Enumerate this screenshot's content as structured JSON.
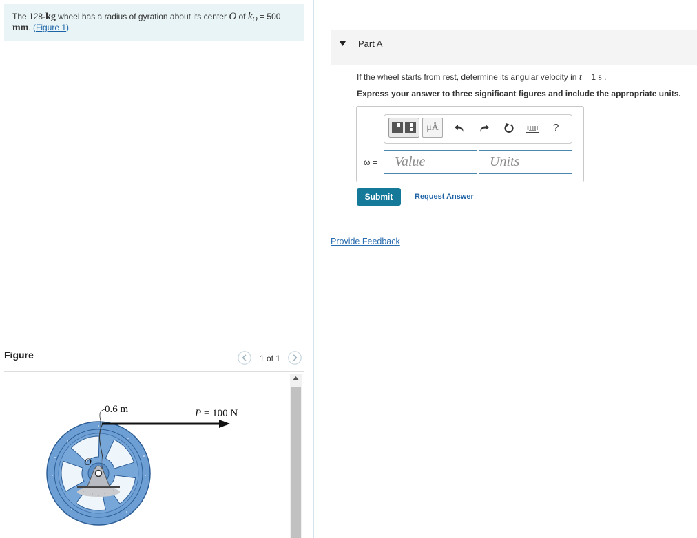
{
  "problem": {
    "text_1": "The 128-",
    "kg": "kg",
    "text_2": " wheel has a radius of gyration about its center ",
    "center_symbol": "O",
    "text_3": " of ",
    "k_symbol": "k",
    "k_subscript": "O",
    "text_4": " = 500",
    "unit": "mm",
    "text_5": ". ",
    "paren_open": "(",
    "figure_link": "Figure 1",
    "paren_close": ")"
  },
  "figure_panel": {
    "title": "Figure",
    "pager": "1 of 1",
    "prev_icon": "chevron-left-icon",
    "next_icon": "chevron-right-icon",
    "labels": {
      "radius": "0.6 m",
      "force_symbol": "P",
      "force_value": " = 100 N",
      "center_symbol": "O"
    }
  },
  "part_a": {
    "toggle_icon": "caret-down-icon",
    "title": "Part A",
    "question": {
      "text_1": "If the wheel starts from rest, determine its angular velocity in ",
      "t_symbol": "t",
      "text_2": " = 1 ",
      "s_unit": "s",
      "text_3": " ."
    },
    "instruction": "Express your answer to three significant figures and include the appropriate units.",
    "toolbar": {
      "templates_icon": "templates-icon",
      "units_button_label": "μÅ",
      "undo_icon": "undo-icon",
      "redo_icon": "redo-icon",
      "reset_icon": "reset-icon",
      "keyboard_icon": "keyboard-icon",
      "help_label": "?"
    },
    "answer": {
      "label": "ω =",
      "value": "",
      "value_placeholder": "Value",
      "units": "",
      "units_placeholder": "Units"
    },
    "submit_label": "Submit",
    "request_answer_label": "Request Answer"
  },
  "provide_feedback_label": "Provide Feedback",
  "colors": {
    "problem_background": "#e8f4f6",
    "link": "#1c64a8",
    "submit_background": "#15799a",
    "wheel": "#6e9fd4"
  }
}
